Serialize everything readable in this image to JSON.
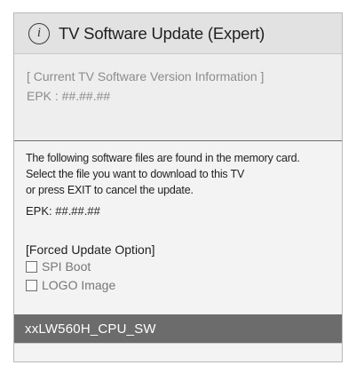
{
  "dialog": {
    "title": "TV Software Update (Expert)",
    "info_icon_glyph": "i"
  },
  "current": {
    "heading": "[ Current TV Software Version Information ]",
    "epk": "EPK : ##.##.##"
  },
  "message": {
    "line1": "The following software files are found in the memory card.",
    "line2": "Select the file you want to download to this TV",
    "line3": "or press EXIT to cancel the update."
  },
  "found": {
    "epk": "EPK: ##.##.##"
  },
  "forced_update": {
    "heading": "[Forced Update Option]",
    "options": [
      {
        "label": "SPI Boot",
        "checked": false
      },
      {
        "label": "LOGO Image",
        "checked": false
      }
    ]
  },
  "files": {
    "selected": "xxLW560H_CPU_SW"
  },
  "colors": {
    "selection": "#6c6c6c",
    "dialog_bg": "#f0f0f0",
    "title_bg": "#e2e2e2"
  }
}
